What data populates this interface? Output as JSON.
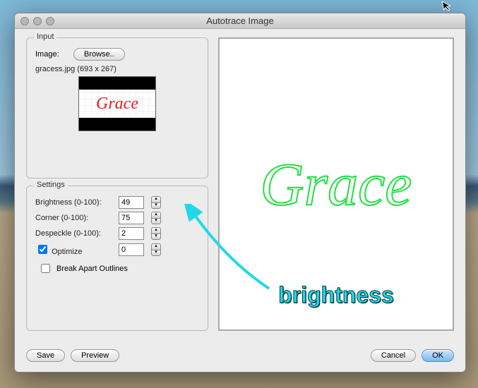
{
  "window": {
    "title": "Autotrace Image"
  },
  "input": {
    "group_label": "Input",
    "image_label": "Image:",
    "browse_label": "Browse..",
    "filename": "gracess.jpg (693 x 267)",
    "thumb_text": "Grace"
  },
  "settings": {
    "group_label": "Settings",
    "brightness_label": "Brightness (0-100):",
    "brightness_value": "49",
    "corner_label": "Corner (0-100):",
    "corner_value": "75",
    "despeckle_label": "Despeckle (0-100):",
    "despeckle_value": "2",
    "optimize_label": "Optimize",
    "optimize_value": "0",
    "optimize_checked": true,
    "break_apart_label": "Break Apart Outlines",
    "break_apart_checked": false
  },
  "preview": {
    "trace_text": "Grace",
    "annotation": "brightness"
  },
  "footer": {
    "save_label": "Save",
    "preview_label": "Preview",
    "cancel_label": "Cancel",
    "ok_label": "OK"
  }
}
